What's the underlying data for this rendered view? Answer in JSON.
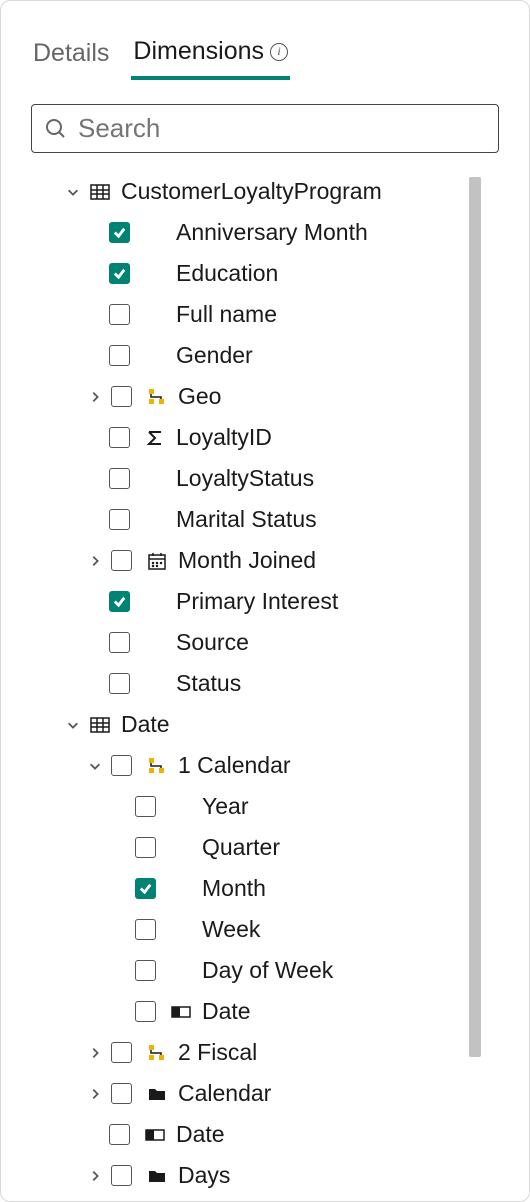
{
  "tabs": {
    "details": "Details",
    "dimensions": "Dimensions"
  },
  "search": {
    "placeholder": "Search"
  },
  "tree": {
    "custLoyalty": {
      "label": "CustomerLoyaltyProgram",
      "anniversary": "Anniversary Month",
      "education": "Education",
      "fullName": "Full name",
      "gender": "Gender",
      "geo": "Geo",
      "loyaltyId": "LoyaltyID",
      "loyaltyStatus": "LoyaltyStatus",
      "maritalStatus": "Marital Status",
      "monthJoined": "Month Joined",
      "primaryInterest": "Primary Interest",
      "source": "Source",
      "status": "Status"
    },
    "date": {
      "label": "Date",
      "cal1": {
        "label": "1 Calendar",
        "year": "Year",
        "quarter": "Quarter",
        "month": "Month",
        "week": "Week",
        "dow": "Day of Week",
        "date": "Date"
      },
      "fiscal2": "2 Fiscal",
      "calendar": "Calendar",
      "date2": "Date",
      "days": "Days"
    }
  }
}
